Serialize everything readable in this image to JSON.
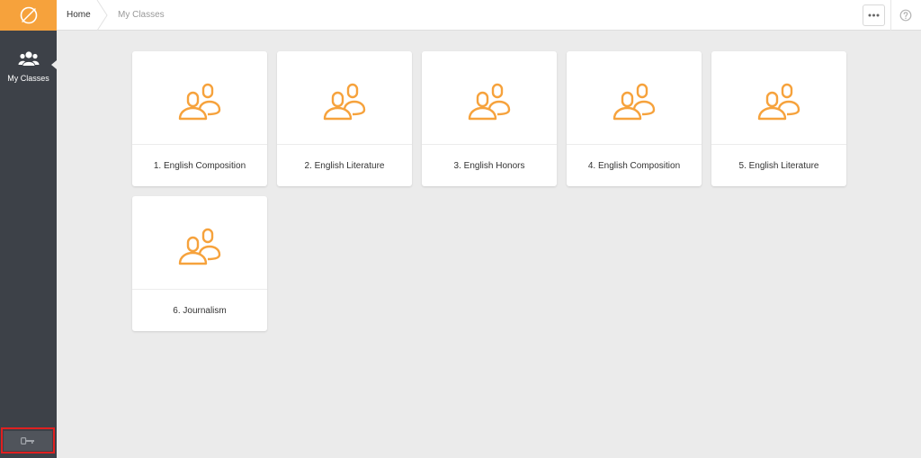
{
  "colors": {
    "accent": "#f6a23c",
    "sidebar": "#3d4148",
    "highlight": "#e02020"
  },
  "sidebar": {
    "logo_icon": "compass-icon",
    "items": [
      {
        "label": "My Classes",
        "icon": "users-icon"
      }
    ],
    "logout_icon": "key-icon"
  },
  "breadcrumb": {
    "home": "Home",
    "current": "My Classes"
  },
  "header": {
    "more_icon": "ellipsis-icon",
    "help_icon": "help-icon"
  },
  "classes": [
    {
      "label": "1. English Composition"
    },
    {
      "label": "2. English Literature"
    },
    {
      "label": "3. English Honors"
    },
    {
      "label": "4. English Composition"
    },
    {
      "label": "5. English Literature"
    },
    {
      "label": "6. Journalism"
    }
  ]
}
